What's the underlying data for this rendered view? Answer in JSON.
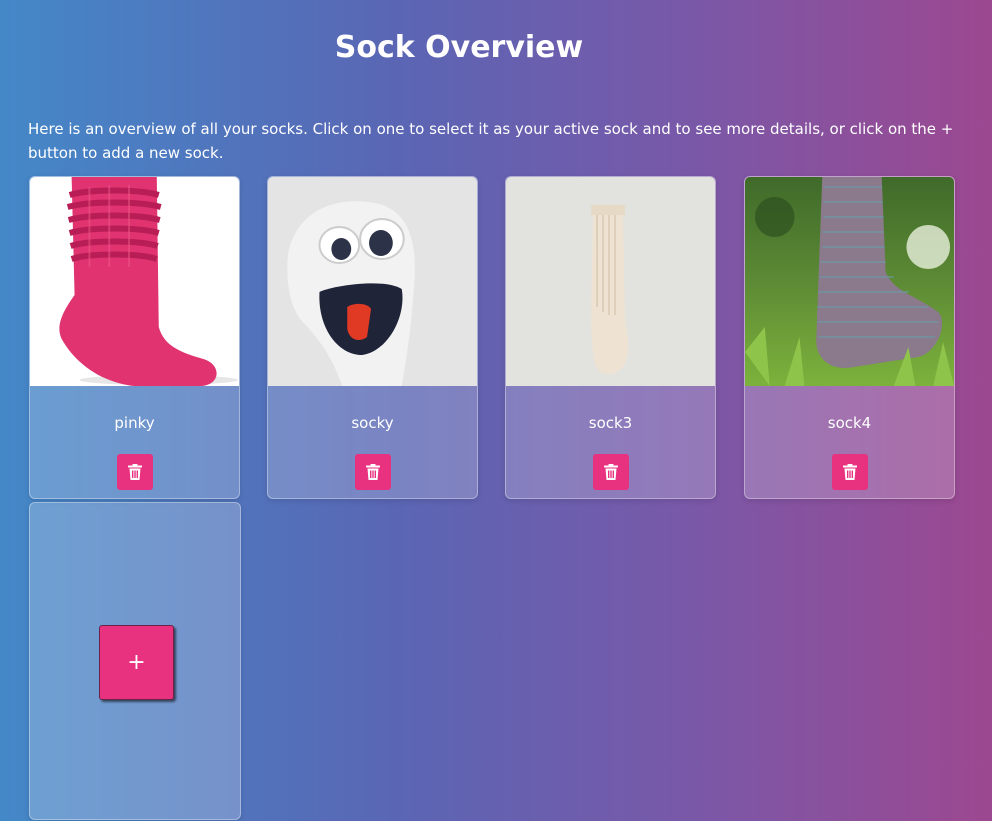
{
  "header": {
    "title": "Sock Overview"
  },
  "intro": {
    "text": "Here is an overview of all your socks. Click on one to select it as your active sock and to see more details, or click on the + button to add a new sock."
  },
  "socks": [
    {
      "name": "pinky",
      "image_icon": "pink-sock-photo"
    },
    {
      "name": "socky",
      "image_icon": "sock-puppet-photo"
    },
    {
      "name": "sock3",
      "image_icon": "cream-sock-photo"
    },
    {
      "name": "sock4",
      "image_icon": "knitted-sock-photo"
    }
  ],
  "add_button": {
    "label": "+"
  },
  "icons": {
    "delete": "trash-icon"
  },
  "colors": {
    "accent": "#e8317f",
    "gradient_start": "#4488c8",
    "gradient_end": "#9c4890"
  }
}
